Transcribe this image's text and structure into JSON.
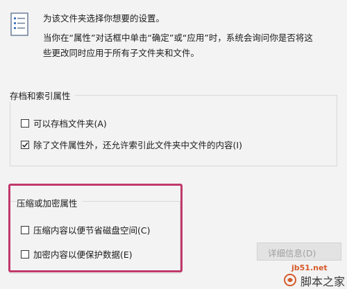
{
  "intro": {
    "line1": "为该文件夹选择你想要的设置。",
    "line2": "当你在“属性”对话框中单击“确定”或“应用”时，系统会询问你是否将这",
    "line3": "些更改同时应用于所有子文件夹和文件。",
    "icon": "document-settings-icon"
  },
  "archive_group": {
    "title": "存档和索引属性",
    "items": [
      {
        "label": "可以存档文件夹(A)",
        "checked": false
      },
      {
        "label": "除了文件属性外，还允许索引此文件夹中文件的内容(I)",
        "checked": true
      }
    ]
  },
  "compress_group": {
    "title": "压缩或加密属性",
    "items": [
      {
        "label": "压缩内容以便节省磁盘空间(C)",
        "checked": false
      },
      {
        "label": "加密内容以便保护数据(E)",
        "checked": false
      }
    ],
    "highlight_color": "#c0396b"
  },
  "details_button": {
    "label": "详细信息(D)"
  },
  "watermark": {
    "site": "jb51.net",
    "brand": "脚本之家",
    "color": "#d65a2a"
  }
}
